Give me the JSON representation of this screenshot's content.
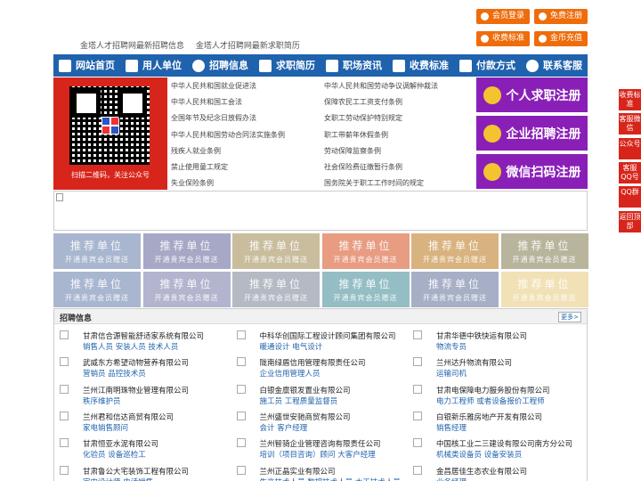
{
  "ticker": [
    "金塔人才招聘网最新招聘信息",
    "金塔人才招聘网最新求职简历"
  ],
  "top_buttons": {
    "member_login": "会员登录",
    "free_register": "免费注册",
    "fee_standard": "收费标准",
    "coin_recharge": "金币充值"
  },
  "nav": [
    "网站首页",
    "用人单位",
    "招聘信息",
    "求职简历",
    "职场资讯",
    "收费标准",
    "付款方式",
    "联系客服"
  ],
  "qr_caption": "扫描二维码，关注公众号",
  "laws_left": [
    "中华人民共和国就业促进法",
    "中华人民共和国工会法",
    "全国年节及纪念日放假办法",
    "中华人民共和国劳动合同法实施条例",
    "残疾人就业条例",
    "禁止使用童工规定",
    "失业保险条例"
  ],
  "laws_right": [
    "中华人民共和国劳动争议调解仲裁法",
    "保障农民工工资支付条例",
    "女职工劳动保护特别规定",
    "职工带薪年休假条例",
    "劳动保障监察条例",
    "社会保险费征缴暂行条例",
    "国务院关于职工工作时间的规定"
  ],
  "register_buttons": [
    "个人求职注册",
    "企业招聘注册",
    "微信扫码注册"
  ],
  "ad_slots": {
    "title": "推荐单位",
    "subtitle": "开通贵宾会员赠送",
    "colors": [
      "#a9b6cf",
      "#a7a8c6",
      "#c9bd9d",
      "#e89c82",
      "#d8b37f",
      "#b9b59d",
      "#a9b6cf",
      "#b3b4cd",
      "#b4bac3",
      "#94bec4",
      "#a7afc6",
      "#f2e1b7"
    ]
  },
  "jobs_section": {
    "title": "招聘信息",
    "more": "更多>",
    "items": [
      {
        "company": "甘肃信合源智能舒适家系统有限公司",
        "positions": "销售人员 安装人员 技术人员"
      },
      {
        "company": "中科华创国际工程设计顾问集团有限公司",
        "positions": "暖通设计 电气设计"
      },
      {
        "company": "甘肃华德中铁快运有限公司",
        "positions": "物流专员"
      },
      {
        "company": "武威东方希望动物营养有限公司",
        "positions": "营销员 品控技术员"
      },
      {
        "company": "陇南绿盾信用管理有限责任公司",
        "positions": "企业信用管理人员"
      },
      {
        "company": "兰州达升物流有限公司",
        "positions": "运输司机"
      },
      {
        "company": "兰州江南明珠物业管理有限公司",
        "positions": "秩序维护员"
      },
      {
        "company": "白银金廪银发置业有限公司",
        "positions": "施工员 工程质量监督员"
      },
      {
        "company": "甘肃电保障电力服务股份有限公司",
        "positions": "电力工程师 或者设备报价工程师"
      },
      {
        "company": "兰州君和信达商贸有限公司",
        "positions": "家电销售顾问"
      },
      {
        "company": "兰州盛世安驰商贸有限公司",
        "positions": "会计 客户经理"
      },
      {
        "company": "白银新乐雅房地产开发有限公司",
        "positions": "销售经理"
      },
      {
        "company": "甘肃恒亚水泥有限公司",
        "positions": "化验员 设备巡检工"
      },
      {
        "company": "兰州智骑企业管理咨询有限责任公司",
        "positions": "培训（项目咨询）顾问 大客户经理"
      },
      {
        "company": "中国核工业二三建设有限公司南方分公司",
        "positions": "机械类设备员 设备安装员"
      },
      {
        "company": "甘肃鲁公大宅装饰工程有限公司",
        "positions": "室内设计师 电话销售"
      },
      {
        "company": "兰州正晶实业有限公司",
        "positions": "生产技术人员 数控技术人员 木工技术人员"
      },
      {
        "company": "金昌居佳生态农业有限公司",
        "positions": "业务经理"
      }
    ]
  },
  "side_tabs": [
    "收费标准",
    "客服微信",
    "公众号",
    "客服QQ号",
    "QQ群",
    "返回顶部"
  ],
  "colors": {
    "nav_blue": "#1f62ad",
    "accent_orange": "#ef6c0b",
    "register_purple": "#8a1fb8",
    "qr_red": "#d8251b"
  }
}
